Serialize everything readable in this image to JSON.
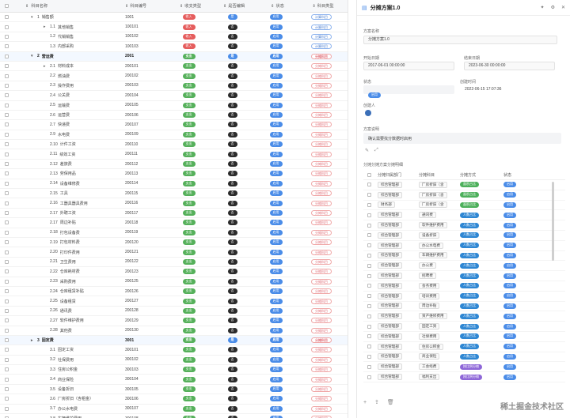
{
  "table": {
    "headers": [
      "科目名称",
      "科目编号",
      "收支类型",
      "是否编辑",
      "状态",
      "科目类型"
    ],
    "rows": [
      {
        "level": 1,
        "expand": "open",
        "num": "1",
        "name": "销售额",
        "code": "1001",
        "flow": "收入",
        "edit": "是",
        "status": "启用",
        "type": "计算科目"
      },
      {
        "level": 2,
        "expand": "closed",
        "num": "1.1",
        "name": "其他销售",
        "code": "100101",
        "flow": "收入",
        "edit": "否",
        "status": "启用",
        "type": "计算科目"
      },
      {
        "level": 2,
        "num": "1.2",
        "name": "代销销售",
        "code": "100102",
        "flow": "收入",
        "edit": "否",
        "status": "启用",
        "type": "计算科目"
      },
      {
        "level": 2,
        "num": "1.3",
        "name": "内部采购",
        "code": "100103",
        "flow": "收入",
        "edit": "否",
        "status": "启用",
        "type": "计算科目"
      },
      {
        "level": 1,
        "expand": "open",
        "num": "2",
        "name": "营运费",
        "code": "2001",
        "flow": "支出",
        "edit": "是",
        "status": "启用",
        "type": "分摊科目",
        "group": true
      },
      {
        "level": 2,
        "expand": "closed",
        "num": "2.1",
        "name": "材料成本",
        "code": "200101",
        "flow": "支出",
        "edit": "否",
        "status": "启用",
        "type": "分摊科目"
      },
      {
        "level": 2,
        "num": "2.2",
        "name": "燃油费",
        "code": "200102",
        "flow": "支出",
        "edit": "否",
        "status": "启用",
        "type": "分摊科目"
      },
      {
        "level": 2,
        "num": "2.3",
        "name": "操作费用",
        "code": "200103",
        "flow": "支出",
        "edit": "否",
        "status": "启用",
        "type": "分摊科目"
      },
      {
        "level": 2,
        "num": "2.4",
        "name": "公关费",
        "code": "200104",
        "flow": "支出",
        "edit": "否",
        "status": "启用",
        "type": "分摊科目"
      },
      {
        "level": 2,
        "num": "2.5",
        "name": "运输费",
        "code": "200105",
        "flow": "支出",
        "edit": "否",
        "status": "启用",
        "type": "分摊科目"
      },
      {
        "level": 2,
        "num": "2.6",
        "name": "运营费",
        "code": "200106",
        "flow": "支出",
        "edit": "否",
        "status": "启用",
        "type": "分摊科目"
      },
      {
        "level": 2,
        "num": "2.7",
        "name": "快递费",
        "code": "200107",
        "flow": "支出",
        "edit": "否",
        "status": "启用",
        "type": "分摊科目"
      },
      {
        "level": 2,
        "num": "2.9",
        "name": "水电费",
        "code": "200109",
        "flow": "支出",
        "edit": "否",
        "status": "启用",
        "type": "分摊科目"
      },
      {
        "level": 2,
        "num": "2.10",
        "name": "计件工资",
        "code": "200110",
        "flow": "支出",
        "edit": "否",
        "status": "启用",
        "type": "分摊科目"
      },
      {
        "level": 2,
        "num": "2.11",
        "name": "绩效工资",
        "code": "200111",
        "flow": "支出",
        "edit": "否",
        "status": "启用",
        "type": "分摊科目"
      },
      {
        "level": 2,
        "num": "2.12",
        "name": "差旅费",
        "code": "200112",
        "flow": "支出",
        "edit": "否",
        "status": "启用",
        "type": "分摊科目"
      },
      {
        "level": 2,
        "num": "2.13",
        "name": "劳保用品",
        "code": "200113",
        "flow": "支出",
        "edit": "否",
        "status": "启用",
        "type": "分摊科目"
      },
      {
        "level": 2,
        "num": "2.14",
        "name": "设备维修费",
        "code": "200114",
        "flow": "支出",
        "edit": "否",
        "status": "启用",
        "type": "分摊科目"
      },
      {
        "level": 2,
        "num": "2.15",
        "name": "工具",
        "code": "200115",
        "flow": "支出",
        "edit": "否",
        "status": "启用",
        "type": "分摊科目"
      },
      {
        "level": 2,
        "num": "2.16",
        "name": "工器具器具费用",
        "code": "200116",
        "flow": "支出",
        "edit": "否",
        "status": "启用",
        "type": "分摊科目"
      },
      {
        "level": 2,
        "num": "2.17",
        "name": "外聘工资",
        "code": "200117",
        "flow": "支出",
        "edit": "否",
        "status": "启用",
        "type": "分摊科目"
      },
      {
        "level": 2,
        "num": "2.17",
        "name": "周边补贴",
        "code": "200118",
        "flow": "支出",
        "edit": "否",
        "status": "启用",
        "type": "分摊科目"
      },
      {
        "level": 2,
        "num": "2.18",
        "name": "打包设备费",
        "code": "200119",
        "flow": "支出",
        "edit": "否",
        "status": "启用",
        "type": "分摊科目"
      },
      {
        "level": 2,
        "num": "2.19",
        "name": "打包材料费",
        "code": "200120",
        "flow": "支出",
        "edit": "否",
        "status": "启用",
        "type": "分摊科目"
      },
      {
        "level": 2,
        "num": "2.20",
        "name": "打印件费用",
        "code": "200121",
        "flow": "支出",
        "edit": "否",
        "status": "启用",
        "type": "分摊科目"
      },
      {
        "level": 2,
        "num": "2.21",
        "name": "卫生费用",
        "code": "200122",
        "flow": "支出",
        "edit": "否",
        "status": "启用",
        "type": "分摊科目"
      },
      {
        "level": 2,
        "num": "2.22",
        "name": "仓库耗材费",
        "code": "200123",
        "flow": "支出",
        "edit": "否",
        "status": "启用",
        "type": "分摊科目"
      },
      {
        "level": 2,
        "num": "2.23",
        "name": "采购费用",
        "code": "200125",
        "flow": "支出",
        "edit": "否",
        "status": "启用",
        "type": "分摊科目"
      },
      {
        "level": 2,
        "num": "2.24",
        "name": "仓库租赁补贴",
        "code": "200126",
        "flow": "支出",
        "edit": "否",
        "status": "启用",
        "type": "分摊科目"
      },
      {
        "level": 2,
        "num": "2.25",
        "name": "设备租赁",
        "code": "200127",
        "flow": "支出",
        "edit": "否",
        "status": "启用",
        "type": "分摊科目"
      },
      {
        "level": 2,
        "num": "2.26",
        "name": "通讯费",
        "code": "200128",
        "flow": "支出",
        "edit": "否",
        "status": "启用",
        "type": "分摊科目"
      },
      {
        "level": 2,
        "num": "2.27",
        "name": "软件维护费用",
        "code": "200129",
        "flow": "支出",
        "edit": "否",
        "status": "启用",
        "type": "分摊科目"
      },
      {
        "level": 2,
        "num": "2.28",
        "name": "其他费",
        "code": "200130",
        "flow": "支出",
        "edit": "否",
        "status": "启用",
        "type": "分摊科目"
      },
      {
        "level": 1,
        "expand": "closed",
        "num": "3",
        "name": "固定费",
        "code": "3001",
        "flow": "支出",
        "edit": "是",
        "status": "启用",
        "type": "分摊科目",
        "group": true
      },
      {
        "level": 2,
        "num": "3.1",
        "name": "固定工资",
        "code": "300101",
        "flow": "支出",
        "edit": "否",
        "status": "启用",
        "type": "分摊科目"
      },
      {
        "level": 2,
        "num": "3.2",
        "name": "社保费用",
        "code": "300102",
        "flow": "支出",
        "edit": "否",
        "status": "启用",
        "type": "分摊科目"
      },
      {
        "level": 2,
        "num": "3.3",
        "name": "住房公积金",
        "code": "300103",
        "flow": "支出",
        "edit": "否",
        "status": "启用",
        "type": "分摊科目"
      },
      {
        "level": 2,
        "num": "3.4",
        "name": "商业保险",
        "code": "300104",
        "flow": "支出",
        "edit": "否",
        "status": "启用",
        "type": "分摊科目"
      },
      {
        "level": 2,
        "num": "3.5",
        "name": "设备折旧",
        "code": "300105",
        "flow": "支出",
        "edit": "否",
        "status": "启用",
        "type": "分摊科目"
      },
      {
        "level": 2,
        "num": "3.6",
        "name": "厂房折旧（含租金）",
        "code": "300106",
        "flow": "支出",
        "edit": "否",
        "status": "启用",
        "type": "分摊科目"
      },
      {
        "level": 2,
        "num": "3.7",
        "name": "办公水电费",
        "code": "300107",
        "flow": "支出",
        "edit": "否",
        "status": "启用",
        "type": "分摊科目"
      },
      {
        "level": 2,
        "num": "3.8",
        "name": "车辆维护费用",
        "code": "300108",
        "flow": "支出",
        "edit": "否",
        "status": "启用",
        "type": "分摊科目"
      },
      {
        "level": 2,
        "num": "3.9",
        "name": "工会经费",
        "code": "300109",
        "flow": "支出",
        "edit": "否",
        "status": "启用",
        "type": "分摊科目"
      }
    ]
  },
  "panel": {
    "title": "分摊方案1.0",
    "name_label": "方案名称",
    "name_value": "分摊方案1.0",
    "start_label": "开始日期",
    "start_value": "2017-06-01 00:00:00",
    "end_label": "结束日期",
    "end_value": "2023-06-30 00:00:00",
    "status_label": "状态",
    "status_value": "启用",
    "created_label": "创建时间",
    "created_value": "2022-06-15 17:07:36",
    "creator_label": "创建人",
    "desc_label": "方案说明",
    "desc_value": "确认需要找分数据时启用",
    "detail_label": "分摊分摊方案分摊明细",
    "detail_headers": [
      "分摊归属部门",
      "分摊科目",
      "分摊方式",
      "状态"
    ],
    "detail_rows": [
      {
        "dept": "综合管理部",
        "subject": "厂房折旧（含",
        "method": "面积占比",
        "mtype": "sq",
        "status": "启用"
      },
      {
        "dept": "综合管理部",
        "subject": "厂房折旧（含",
        "method": "面积占比",
        "mtype": "sq",
        "status": "启用"
      },
      {
        "dept": "财务部",
        "subject": "厂房折旧（含",
        "method": "面积占比",
        "mtype": "sq",
        "status": "启用"
      },
      {
        "dept": "综合管理部",
        "subject": "通讯费",
        "method": "人数占比",
        "mtype": "per",
        "status": "启用"
      },
      {
        "dept": "综合管理部",
        "subject": "软件维护费用",
        "method": "人数占比",
        "mtype": "per",
        "status": "启用"
      },
      {
        "dept": "综合管理部",
        "subject": "设备折旧",
        "method": "人数占比",
        "mtype": "per",
        "status": "启用"
      },
      {
        "dept": "综合管理部",
        "subject": "办公水电费",
        "method": "人数占比",
        "mtype": "per",
        "status": "启用"
      },
      {
        "dept": "综合管理部",
        "subject": "车辆维护费用",
        "method": "人数占比",
        "mtype": "per",
        "status": "启用"
      },
      {
        "dept": "综合管理部",
        "subject": "办公费",
        "method": "人数占比",
        "mtype": "per",
        "status": "启用"
      },
      {
        "dept": "综合管理部",
        "subject": "招聘费",
        "method": "人数占比",
        "mtype": "per",
        "status": "启用"
      },
      {
        "dept": "综合管理部",
        "subject": "会务费用",
        "method": "人数占比",
        "mtype": "per",
        "status": "启用"
      },
      {
        "dept": "综合管理部",
        "subject": "培训费用",
        "method": "人数占比",
        "mtype": "per",
        "status": "启用"
      },
      {
        "dept": "综合管理部",
        "subject": "周边补贴",
        "method": "人数占比",
        "mtype": "per",
        "status": "启用"
      },
      {
        "dept": "综合管理部",
        "subject": "资产维修费用",
        "method": "人数占比",
        "mtype": "per",
        "status": "启用"
      },
      {
        "dept": "综合管理部",
        "subject": "固定工资",
        "method": "人数占比",
        "mtype": "per",
        "status": "启用"
      },
      {
        "dept": "综合管理部",
        "subject": "社保费用",
        "method": "人数占比",
        "mtype": "per",
        "status": "启用"
      },
      {
        "dept": "综合管理部",
        "subject": "住房公积金",
        "method": "人数占比",
        "mtype": "per",
        "status": "启用"
      },
      {
        "dept": "综合管理部",
        "subject": "商业保险",
        "method": "人数占比",
        "mtype": "per",
        "status": "启用"
      },
      {
        "dept": "综合管理部",
        "subject": "工会经费",
        "method": "按比例分摊",
        "mtype": "ratio",
        "status": "启用"
      },
      {
        "dept": "综合管理部",
        "subject": "福利支出",
        "method": "按比例分摊",
        "mtype": "ratio",
        "status": "启用"
      }
    ]
  },
  "watermark": "稀土掘金技术社区",
  "colors": {
    "accent": "#4a8ce8",
    "income": "#e55c5c",
    "expense": "#55b05a",
    "no": "#2b2b2b"
  }
}
